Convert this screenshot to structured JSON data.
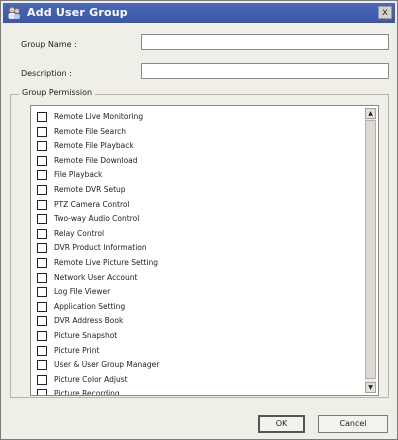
{
  "window": {
    "title": "Add User Group",
    "close_glyph": "x"
  },
  "form": {
    "group_name_label": "Group Name :",
    "group_name_value": "",
    "description_label": "Description :",
    "description_value": ""
  },
  "permissions": {
    "title": "Group Permission",
    "items": [
      "Remote Live Monitoring",
      "Remote File Search",
      "Remote File Playback",
      "Remote File Download",
      "File Playback",
      "Remote DVR Setup",
      "PTZ Camera Control",
      "Two-way Audio Control",
      "Relay Control",
      "DVR Product Information",
      "Remote Live Picture Setting",
      "Network User Account",
      "Log File Viewer",
      "Application Setting",
      "DVR Address Book",
      "Picture Snapshot",
      "Picture Print",
      "User & User Group Manager",
      "Picture Color Adjust",
      "Picture Recording"
    ]
  },
  "buttons": {
    "ok": "OK",
    "cancel": "Cancel"
  },
  "colors": {
    "titlebar": "#3a57a8",
    "dialog_bg": "#f0efe7"
  }
}
